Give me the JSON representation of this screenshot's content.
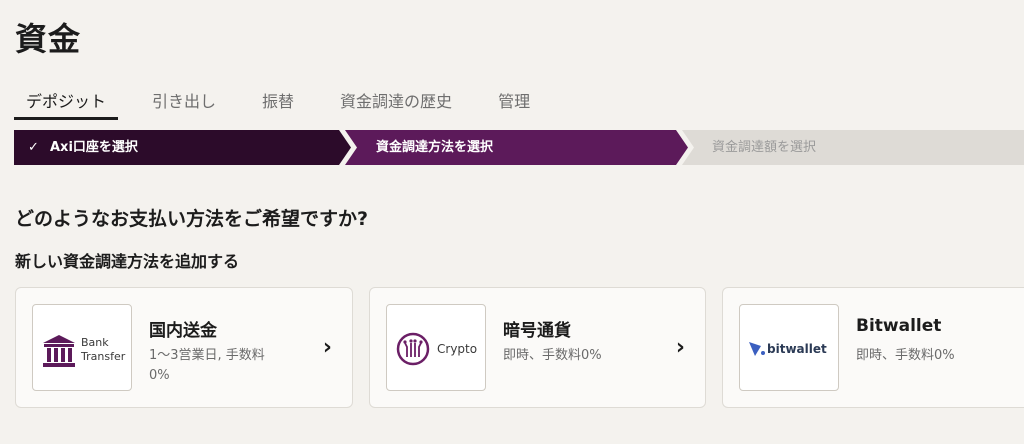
{
  "page": {
    "title": "資金"
  },
  "tabs": [
    {
      "label": "デポジット",
      "active": true
    },
    {
      "label": "引き出し",
      "active": false
    },
    {
      "label": "振替",
      "active": false
    },
    {
      "label": "資金調達の歴史",
      "active": false
    },
    {
      "label": "管理",
      "active": false
    }
  ],
  "stepper": {
    "steps": [
      {
        "label": "Axi口座を選択",
        "state": "completed"
      },
      {
        "label": "資金調達方法を選択",
        "state": "current"
      },
      {
        "label": "資金調達額を選択",
        "state": "upcoming"
      }
    ]
  },
  "question": "どのようなお支払い方法をご希望ですか?",
  "add_method_heading": "新しい資金調達方法を追加する",
  "methods": [
    {
      "title": "国内送金",
      "desc": "1〜3営業日, 手数料0%",
      "icon": "bank-icon",
      "icon_label_line1": "Bank",
      "icon_label_line2": "Transfer"
    },
    {
      "title": "暗号通貨",
      "desc": "即時、手数料0%",
      "icon": "crypto-icon",
      "icon_label_line1": "Crypto"
    },
    {
      "title": "Bitwallet",
      "desc": "即時、手数料0%",
      "icon": "bitwallet-logo",
      "icon_label_line1": "bitwallet"
    }
  ],
  "colors": {
    "step_completed": "#2c0b2a",
    "step_current": "#5c1a5a",
    "step_upcoming": "#dedbd6",
    "accent_purple": "#6b1f66",
    "bitwallet_blue": "#3b5fc0"
  }
}
